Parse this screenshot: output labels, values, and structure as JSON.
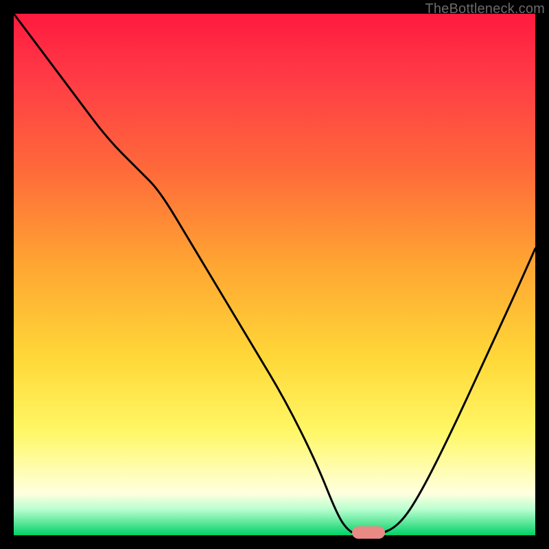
{
  "watermark": "TheBottleneck.com",
  "chart_data": {
    "type": "line",
    "title": "",
    "xlabel": "",
    "ylabel": "",
    "xlim": [
      0,
      100
    ],
    "ylim": [
      0,
      100
    ],
    "series": [
      {
        "name": "bottleneck-curve",
        "x": [
          0,
          6,
          12,
          18,
          24,
          28,
          34,
          40,
          46,
          52,
          58,
          62,
          64,
          66,
          70,
          74,
          78,
          84,
          90,
          96,
          100
        ],
        "y": [
          100,
          92,
          84,
          76,
          70,
          66,
          56,
          46,
          36,
          26,
          14,
          4,
          1,
          0,
          0,
          2,
          8,
          20,
          33,
          46,
          55
        ]
      }
    ],
    "marker": {
      "x": 68,
      "y": 0,
      "color": "#e98a85"
    },
    "background_gradient": {
      "stops": [
        {
          "pos": 0.0,
          "color": "#ff1a3f"
        },
        {
          "pos": 0.3,
          "color": "#ff6a3a"
        },
        {
          "pos": 0.66,
          "color": "#ffd838"
        },
        {
          "pos": 0.86,
          "color": "#fffca0"
        },
        {
          "pos": 1.0,
          "color": "#00d166"
        }
      ]
    }
  }
}
